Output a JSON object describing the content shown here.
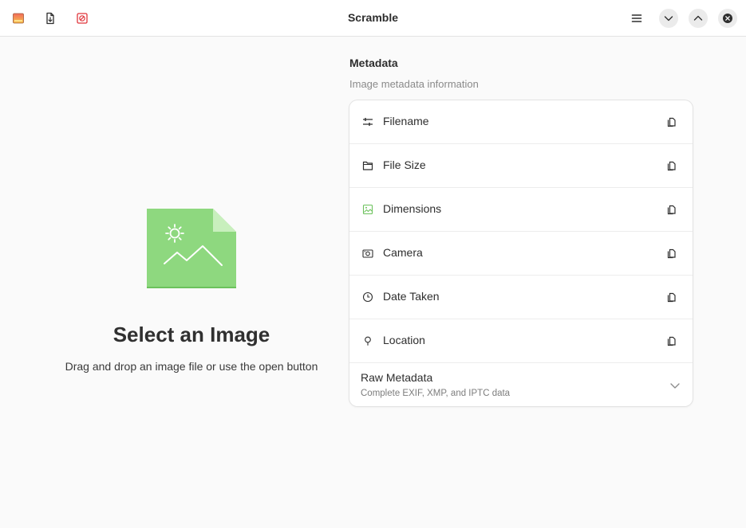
{
  "window": {
    "title": "Scramble"
  },
  "header": {
    "buttons": [
      {
        "name": "app-icon"
      },
      {
        "name": "open-file-icon"
      },
      {
        "name": "clear-metadata-icon"
      }
    ],
    "menu_icon": "hamburger-menu-icon",
    "minimize_icon": "chevron-down-icon",
    "maximize_icon": "chevron-up-icon",
    "close_icon": "close-icon"
  },
  "empty_state": {
    "title": "Select an Image",
    "description": "Drag and drop an image file or use the open button"
  },
  "metadata": {
    "heading": "Metadata",
    "subheading": "Image metadata information",
    "rows": [
      {
        "label": "Filename",
        "icon": "sliders-icon"
      },
      {
        "label": "File Size",
        "icon": "folder-icon"
      },
      {
        "label": "Dimensions",
        "icon": "image-icon"
      },
      {
        "label": "Camera",
        "icon": "camera-icon"
      },
      {
        "label": "Date Taken",
        "icon": "clock-icon"
      },
      {
        "label": "Location",
        "icon": "map-pin-icon"
      }
    ],
    "raw": {
      "label": "Raw Metadata",
      "description": "Complete EXIF, XMP, and IPTC data"
    }
  },
  "colors": {
    "accent_green": "#8ed87f",
    "header_bg": "#ffffff",
    "window_bg": "#fafafa",
    "clear_icon_red": "#e0353b"
  }
}
